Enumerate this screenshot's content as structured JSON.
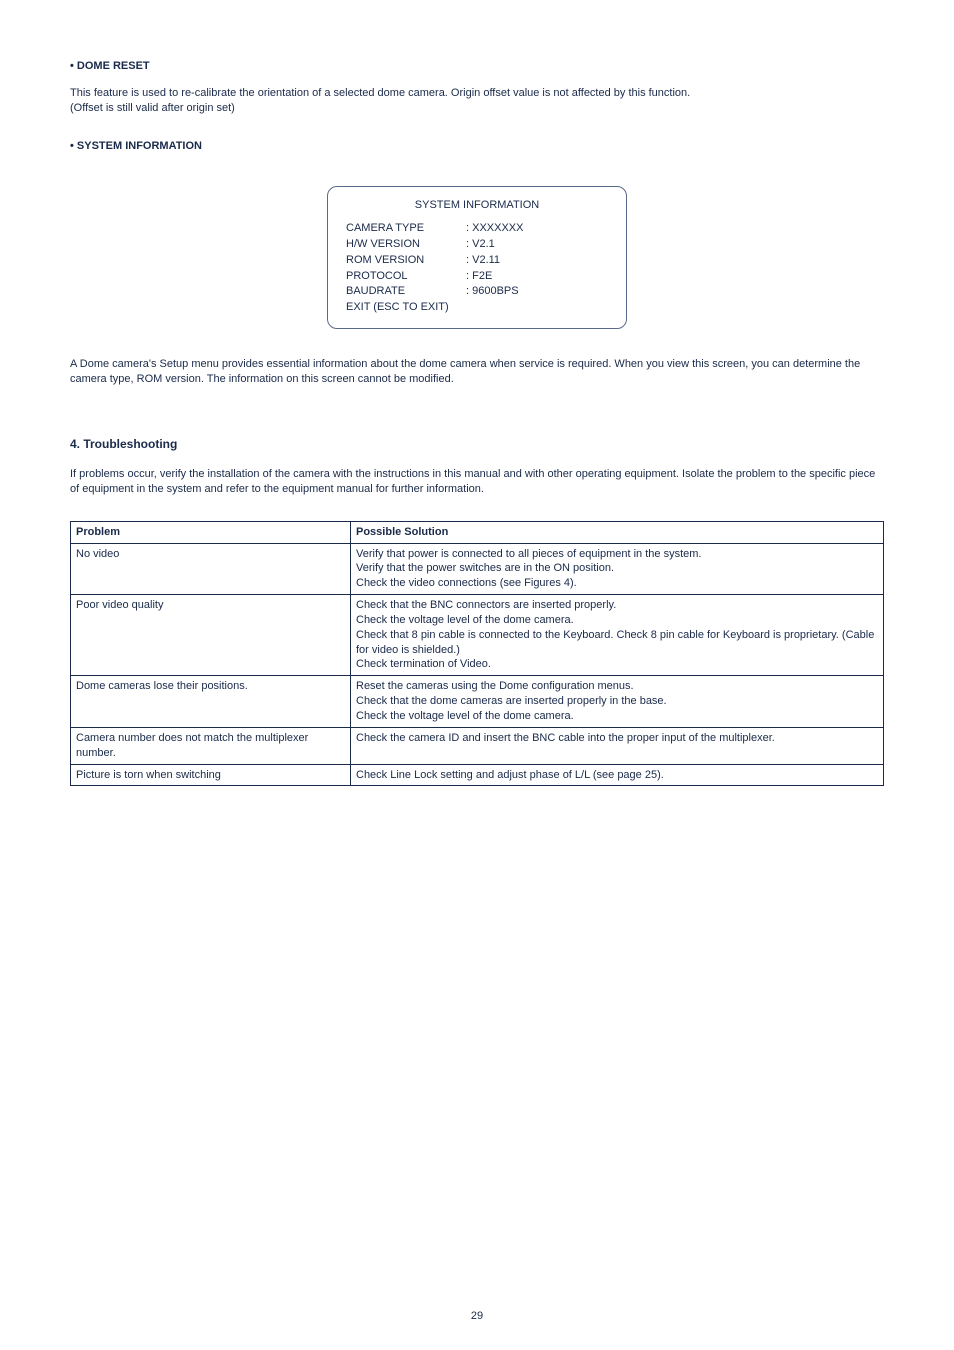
{
  "dome_reset": {
    "header": "•  DOME RESET",
    "paragraph1": "This feature is used to re-calibrate the orientation of a selected dome camera. Origin offset value is not affected by this function.",
    "paragraph2": "(Offset is still valid after origin set)"
  },
  "system_info": {
    "header": "•  SYSTEM INFORMATION",
    "box_title": "SYSTEM INFORMATION",
    "rows": [
      {
        "label": "CAMERA TYPE",
        "value": ": XXXXXXX"
      },
      {
        "label": "H/W VERSION",
        "value": ": V2.1"
      },
      {
        "label": "ROM VERSION",
        "value": ": V2.11"
      },
      {
        "label": "PROTOCOL",
        "value": ": F2E"
      },
      {
        "label": "BAUDRATE",
        "value": ": 9600BPS"
      },
      {
        "label": "EXIT (ESC TO EXIT)",
        "value": ""
      }
    ],
    "paragraph": "A Dome camera's Setup menu provides essential information about the dome camera when service is required. When you view this screen, you can determine the camera type, ROM version. The information on this screen cannot be modified."
  },
  "troubleshoot": {
    "header": "4.  Troubleshooting",
    "intro": "If problems occur, verify the installation of the camera with the instructions in this manual and with other operating equipment. Isolate the problem to the specific piece of equipment in the system and refer to the equipment manual for further information.",
    "col1": "Problem",
    "col2": "Possible Solution",
    "rows": [
      {
        "problem": "No video",
        "solution": "Verify that power is connected to all pieces of equipment in the system.\nVerify that the power switches are in the ON position.\nCheck the video connections (see Figures 4)."
      },
      {
        "problem": "Poor video quality",
        "solution": "Check that the BNC connectors are inserted properly.\nCheck the voltage level of the dome camera.\nCheck that 8 pin cable is connected to the Keyboard.  Check 8 pin cable for Keyboard is proprietary. (Cable for video is shielded.)\nCheck termination of Video."
      },
      {
        "problem": "Dome cameras lose their positions.",
        "solution": "Reset the cameras using the Dome configuration menus.\nCheck that the dome cameras are inserted properly in the base.\nCheck the voltage level of the dome camera."
      },
      {
        "problem": "Camera number does not match the multiplexer number.",
        "solution": "Check the camera ID and insert the BNC cable into the proper input of the multiplexer."
      },
      {
        "problem": "Picture is torn when switching",
        "solution": "Check Line Lock setting and adjust phase of L/L (see page 25)."
      }
    ]
  },
  "page_number": "29"
}
